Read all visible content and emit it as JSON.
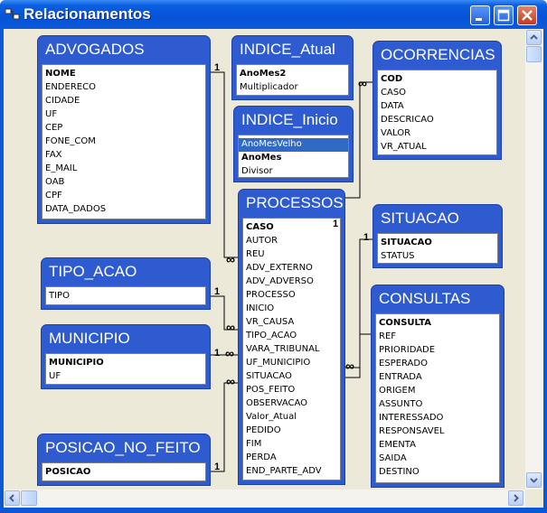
{
  "window": {
    "title": "Relacionamentos"
  },
  "tables": {
    "advogados": {
      "name": "ADVOGADOS",
      "fields": [
        {
          "label": "NOME",
          "key": true
        },
        {
          "label": "ENDERECO"
        },
        {
          "label": "CIDADE"
        },
        {
          "label": "UF"
        },
        {
          "label": "CEP"
        },
        {
          "label": "FONE_COM"
        },
        {
          "label": "FAX"
        },
        {
          "label": "E_MAIL"
        },
        {
          "label": "OAB"
        },
        {
          "label": "CPF"
        },
        {
          "label": "DATA_DADOS"
        }
      ]
    },
    "indice_atual": {
      "name": "INDICE_Atual",
      "fields": [
        {
          "label": "AnoMes2",
          "key": true
        },
        {
          "label": "Multiplicador"
        }
      ]
    },
    "ocorrencias": {
      "name": "OCORRENCIAS",
      "fields": [
        {
          "label": "COD",
          "key": true
        },
        {
          "label": "CASO"
        },
        {
          "label": "DATA"
        },
        {
          "label": "DESCRICAO"
        },
        {
          "label": "VALOR"
        },
        {
          "label": "VR_ATUAL"
        }
      ]
    },
    "indice_inicio": {
      "name": "INDICE_Inicio",
      "fields": [
        {
          "label": "AnoMesVelho",
          "selected": true
        },
        {
          "label": "AnoMes",
          "key": true
        },
        {
          "label": "Divisor"
        }
      ]
    },
    "processos": {
      "name": "PROCESSOS",
      "fields": [
        {
          "label": "CASO",
          "key": true
        },
        {
          "label": "AUTOR"
        },
        {
          "label": "REU"
        },
        {
          "label": "ADV_EXTERNO"
        },
        {
          "label": "ADV_ADVERSO"
        },
        {
          "label": "PROCESSO"
        },
        {
          "label": "INICIO"
        },
        {
          "label": "VR_CAUSA"
        },
        {
          "label": "TIPO_ACAO"
        },
        {
          "label": "VARA_TRIBUNAL"
        },
        {
          "label": "UF_MUNICIPIO"
        },
        {
          "label": "SITUACAO"
        },
        {
          "label": "POS_FEITO"
        },
        {
          "label": "OBSERVACAO"
        },
        {
          "label": "Valor_Atual"
        },
        {
          "label": "PEDIDO"
        },
        {
          "label": "FIM"
        },
        {
          "label": "PERDA"
        },
        {
          "label": "END_PARTE_ADV"
        }
      ]
    },
    "situacao": {
      "name": "SITUACAO",
      "fields": [
        {
          "label": "SITUACAO",
          "key": true
        },
        {
          "label": "STATUS"
        }
      ]
    },
    "tipo_acao": {
      "name": "TIPO_ACAO",
      "fields": [
        {
          "label": "TIPO"
        }
      ]
    },
    "consultas": {
      "name": "CONSULTAS",
      "fields": [
        {
          "label": "CONSULTA",
          "key": true
        },
        {
          "label": "REF"
        },
        {
          "label": "PRIORIDADE"
        },
        {
          "label": "ESPERADO"
        },
        {
          "label": "ENTRADA"
        },
        {
          "label": "ORIGEM"
        },
        {
          "label": "ASSUNTO"
        },
        {
          "label": "INTERESSADO"
        },
        {
          "label": "RESPONSAVEL"
        },
        {
          "label": "EMENTA"
        },
        {
          "label": "SAIDA"
        },
        {
          "label": "DESTINO"
        }
      ]
    },
    "municipio": {
      "name": "MUNICIPIO",
      "fields": [
        {
          "label": "MUNICIPIO",
          "key": true
        },
        {
          "label": "UF"
        }
      ]
    },
    "posicao_no_feito": {
      "name": "POSICAO_NO_FEITO",
      "fields": [
        {
          "label": "POSICAO",
          "key": true
        }
      ]
    }
  },
  "cardinality": {
    "one": "1",
    "many": "∞"
  },
  "colors": {
    "title_bar": "#0a5fe0",
    "table_header": "#2f5bd0",
    "workspace": "#ece9d8",
    "selection": "#316ac5"
  },
  "icons": {
    "window_icon": "relationships-icon",
    "minimize": "minimize-icon",
    "maximize": "maximize-icon",
    "close": "close-icon"
  }
}
